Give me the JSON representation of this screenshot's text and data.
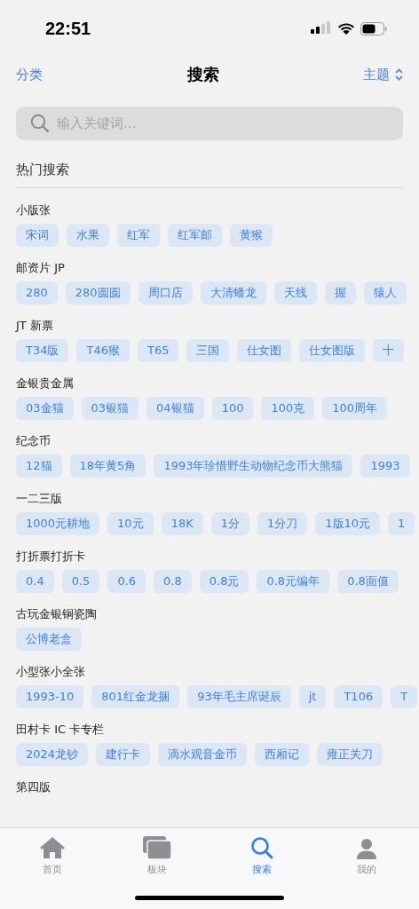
{
  "status_bar": {
    "time": "22:51"
  },
  "nav": {
    "left": "分类",
    "title": "搜索",
    "right": "主题"
  },
  "search": {
    "placeholder": "输入关键词..."
  },
  "section_title": "热门搜索",
  "groups": [
    {
      "title": "小版张",
      "tags": [
        "宋词",
        "水果",
        "红军",
        "红军邮",
        "黄猴"
      ]
    },
    {
      "title": "邮资片 JP",
      "tags": [
        "280",
        "280圆圆",
        "周口店",
        "大清蟠龙",
        "天线",
        "握",
        "猿人"
      ]
    },
    {
      "title": "JT 新票",
      "tags": [
        "T34版",
        "T46猴",
        "T65",
        "三国",
        "仕女图",
        "仕女图版",
        "十"
      ]
    },
    {
      "title": "金银贵金属",
      "tags": [
        "03金猫",
        "03银猫",
        "04银猫",
        "100",
        "100克",
        "100周年"
      ]
    },
    {
      "title": "纪念币",
      "tags": [
        "12猫",
        "18年黄5角",
        "1993年珍惜野生动物纪念币大熊猫",
        "1993"
      ]
    },
    {
      "title": "一二三版",
      "tags": [
        "1000元耕地",
        "10元",
        "18K",
        "1分",
        "1分刀",
        "1版10元",
        "1"
      ]
    },
    {
      "title": "打折票打折卡",
      "tags": [
        "0.4",
        "0.5",
        "0.6",
        "0.8",
        "0.8元",
        "0.8元编年",
        "0.8面值"
      ]
    },
    {
      "title": "古玩金银铜瓷陶",
      "tags": [
        "公博老盒"
      ]
    },
    {
      "title": "小型张小全张",
      "tags": [
        "1993-10",
        "801红金龙捆",
        "93年毛主席诞辰",
        "jt",
        "T106",
        "T"
      ]
    },
    {
      "title": "田村卡 IC 卡专栏",
      "tags": [
        "2024龙钞",
        "建行卡",
        "滴水观音金币",
        "西厢记",
        "雍正关刀"
      ]
    },
    {
      "title": "第四版"
    }
  ],
  "tabs": [
    {
      "label": "首页",
      "kind": "home",
      "selected": false
    },
    {
      "label": "板块",
      "kind": "boards",
      "selected": false
    },
    {
      "label": "搜索",
      "kind": "search",
      "selected": true
    },
    {
      "label": "我的",
      "kind": "profile",
      "selected": false
    }
  ]
}
